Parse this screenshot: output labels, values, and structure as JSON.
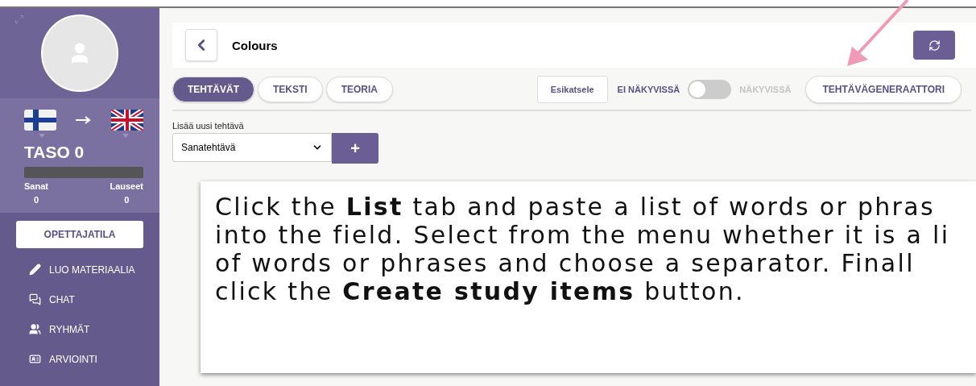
{
  "sidebar": {
    "level_title": "TASO 0",
    "progress": {
      "level": 0
    },
    "stats": [
      {
        "label": "Sanat",
        "value": "0"
      },
      {
        "label": "Lauseet",
        "value": "0"
      }
    ],
    "mode_button": "OPETTAJATILA",
    "items": [
      {
        "kind": "pencil",
        "label": "LUO MATERIAALIA"
      },
      {
        "kind": "chat",
        "label": "CHAT"
      },
      {
        "kind": "users",
        "label": "RYHMÄT"
      },
      {
        "kind": "card",
        "label": "ARVIOINTI"
      }
    ]
  },
  "header": {
    "title": "Colours"
  },
  "tabs": [
    {
      "label": "TEHTÄVÄT",
      "selected": true
    },
    {
      "label": "TEKSTI",
      "selected": false
    },
    {
      "label": "TEORIA",
      "selected": false
    }
  ],
  "preview_button": "Esikatsele",
  "visibility": {
    "off_label": "EI NÄKYVISSÄ",
    "on_label": "NÄKYVISSÄ",
    "on": false
  },
  "generator_button": "TEHTÄVÄGENERAATTORI",
  "new_task": {
    "label": "Lisää uusi tehtävä",
    "value": "Sanatehtävä",
    "add_button": "+"
  },
  "callout": {
    "lines": [
      "Click the **List** tab and paste a list of words or phras",
      "into the field. Select from the menu whether it is a li",
      "of words or phrases and choose a separator. Finall",
      "click the **Create study items** button."
    ]
  }
}
